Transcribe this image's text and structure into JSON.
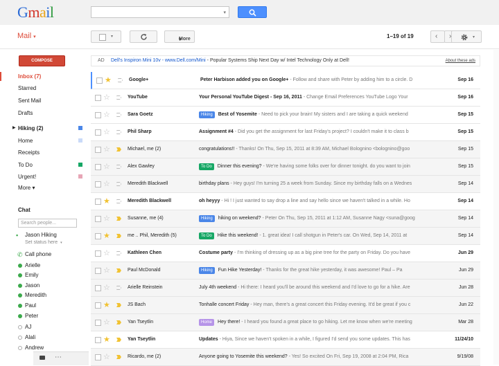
{
  "app": {
    "logo_text": [
      "G",
      "m",
      "a",
      "i",
      "l"
    ]
  },
  "search": {
    "placeholder": "",
    "caret": "▾",
    "button_icon": "search-icon"
  },
  "header": {
    "mail_label": "Mail",
    "mail_caret": "▾"
  },
  "toolbar": {
    "more_label": "More",
    "more_caret": "▾",
    "pager": "1–19 of 19",
    "prev": "‹",
    "next": "›"
  },
  "compose": {
    "label": "COMPOSE"
  },
  "nav": {
    "items": [
      {
        "label": "Inbox (7)",
        "active": true
      },
      {
        "label": "Starred"
      },
      {
        "label": "Sent Mail"
      },
      {
        "label": "Drafts"
      },
      {
        "label": "Hiking (2)",
        "bold": true,
        "expand": "▶",
        "color": "#4a86e8"
      },
      {
        "label": "Home",
        "color": "#c9daf8"
      },
      {
        "label": "Receipts"
      },
      {
        "label": "To Do",
        "color": "#16a765"
      },
      {
        "label": "Urgent!",
        "color": "#e7a6b6"
      },
      {
        "label": "More ▾"
      }
    ]
  },
  "chat": {
    "heading": "Chat",
    "search_placeholder": "Search people...",
    "me": {
      "name": "Jason Hiking",
      "status": "Set status here"
    },
    "contacts": [
      {
        "name": "Call phone",
        "status": "phone"
      },
      {
        "name": "Arielle",
        "status": "online"
      },
      {
        "name": "Emily",
        "status": "online"
      },
      {
        "name": "Jason",
        "status": "online"
      },
      {
        "name": "Meredith",
        "status": "online"
      },
      {
        "name": "Paul",
        "status": "online"
      },
      {
        "name": "Peter",
        "status": "online"
      },
      {
        "name": "AJ",
        "status": "offline"
      },
      {
        "name": "Alali",
        "status": "offline"
      },
      {
        "name": "Andrew",
        "status": "offline"
      }
    ],
    "bar_more": "⋯"
  },
  "ad": {
    "tag": "AD",
    "link": "Dell's Inspiron Mini 10v - www.Dell.com/Mini",
    "text": " - Popular Systems Ship Next Day w/ Intel Technology Only at Dell!",
    "about": "About these ads"
  },
  "label_colors": {
    "Hiking": "#4a86e8",
    "To Do": "#16a765",
    "Home": "#b694e8"
  },
  "emails": [
    {
      "sender": "Google+",
      "subject": "Peter Harbison added you on Google+",
      "snippet": " - Follow and share with Peter by adding him to a circle. D",
      "date": "Sep 16",
      "unread": true,
      "starred": true,
      "important": false,
      "selected": true
    },
    {
      "sender": "YouTube",
      "subject": "Your Personal YouTube Digest - Sep 16, 2011",
      "snippet": " - Change Email Preferences YouTube Logo Your",
      "date": "Sep 16",
      "unread": true,
      "starred": false,
      "important": false
    },
    {
      "sender": "Sara Goetz",
      "label": "Hiking",
      "subject": "Best of Yosemite",
      "snippet": " - Need to pick your brain! My sisters and I are taking a quick weekend",
      "date": "Sep 15",
      "unread": true,
      "starred": false,
      "important": false
    },
    {
      "sender": "Phil Sharp",
      "subject": "Assignment #4",
      "snippet": " - Did you get the assignment for last Friday's project? I couldn't make it to class b",
      "date": "Sep 15",
      "unread": true,
      "starred": false,
      "important": false
    },
    {
      "sender": "Michael, me (2)",
      "subject": "congratulations!!",
      "snippet": " - Thanks! On Thu, Sep 15, 2011 at 8:39 AM, Michael Bolognino <bolognino@goo",
      "date": "Sep 15",
      "unread": false,
      "starred": false,
      "important": true
    },
    {
      "sender": "Alex Gawley",
      "label": "To Do",
      "subject": "Dinner this evening?",
      "snippet": " - We're having some folks over for dinner tonight. do you want to join",
      "date": "Sep 15",
      "unread": false,
      "starred": false,
      "important": false
    },
    {
      "sender": "Meredith Blackwell",
      "subject": "birthday plans",
      "snippet": " - Hey guys! I'm turning 25 a week from Sunday. Since my birthday falls on a Wednes",
      "date": "Sep 14",
      "unread": false,
      "starred": false,
      "important": false
    },
    {
      "sender": "Meredith Blackwell",
      "subject": "oh heyyy",
      "snippet": " - Hi ! I just wanted to say drop a line and say hello since we haven't talked in a while. Ho",
      "date": "Sep 14",
      "unread": true,
      "starred": true,
      "important": false
    },
    {
      "sender": "Susanne, me (4)",
      "label": "Hiking",
      "subject": "hiking on weekend?",
      "snippet": " - Peter On Thu, Sep 15, 2011 at 1:12 AM, Susanne Nagy <suna@goog",
      "date": "Sep 14",
      "unread": false,
      "starred": false,
      "important": true
    },
    {
      "sender": "me .. Phil, Meredith (5)",
      "label": "To Do",
      "subject": "Hike this weekend!",
      "snippet": " - 1. great idea! I call shotgun in Peter's car. On Wed, Sep 14, 2011 at",
      "date": "Sep 14",
      "unread": false,
      "starred": true,
      "important": true
    },
    {
      "sender": "Kathleen Chen",
      "subject": "Costume party",
      "snippet": " - I'm thinking of dressing up as a big pine tree for the party on Friday. Do you have",
      "date": "Jun 29",
      "unread": true,
      "starred": false,
      "important": false
    },
    {
      "sender": "Paul McDonald",
      "label": "Hiking",
      "subject": "Fun Hike Yesterday!",
      "snippet": " - Thanks for the great hike yesterday, it was awesome! Paul – Pa",
      "date": "Jun 29",
      "unread": false,
      "starred": false,
      "important": true
    },
    {
      "sender": "Arielle Reinstein",
      "subject": "July 4th weekend",
      "snippet": " - Hi there: I heard you'll be around this weekend and I'd love to go for a hike. Are",
      "date": "Jun 28",
      "unread": false,
      "starred": false,
      "important": false
    },
    {
      "sender": "JS Bach",
      "subject": "Tonhalle concert Friday",
      "snippet": " - Hey man, there's a great concert this Friday evening. It'd be great if you c",
      "date": "Jun 22",
      "unread": false,
      "starred": true,
      "important": true
    },
    {
      "sender": "Yan Tseytlin",
      "label": "Home",
      "subject": "Hey there!",
      "snippet": " - I heard you found a great place to go hiking. Let me know when we're meeting",
      "date": "Mar 28",
      "unread": false,
      "starred": false,
      "important": true
    },
    {
      "sender": "Yan Tseytlin",
      "subject": "Updates",
      "snippet": " - Hiya, Since we haven't spoken in a while, I figured I'd send you some updates. This has",
      "date": "11/24/10",
      "unread": true,
      "starred": true,
      "important": true
    },
    {
      "sender": "Ricardo, me (2)",
      "subject": "Anyone going to Yosemite this weekend?",
      "snippet": " - Yes! So excited On Fri, Sep 19, 2008 at 2:04 PM, Rica",
      "date": "9/19/08",
      "unread": false,
      "starred": false,
      "important": true
    }
  ]
}
